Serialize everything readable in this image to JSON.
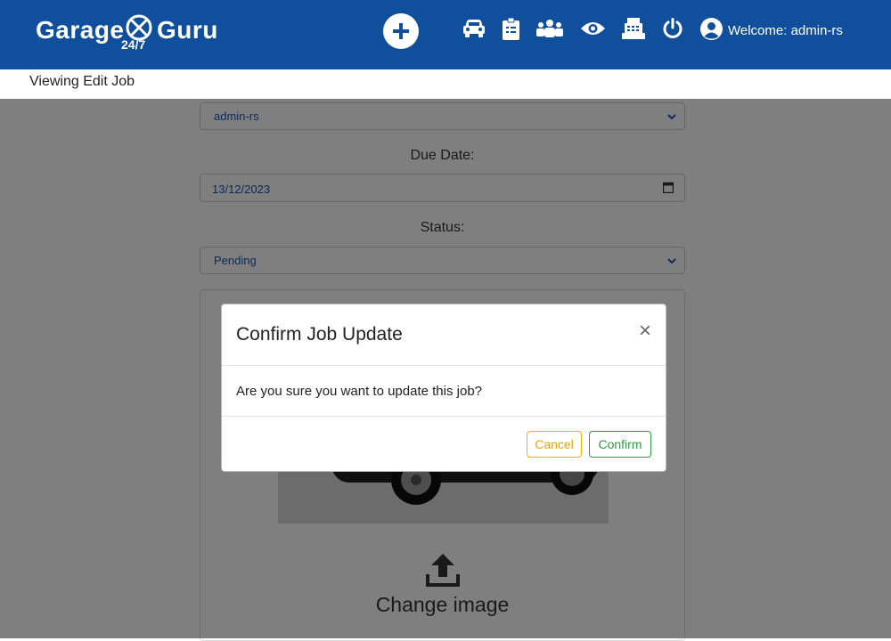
{
  "brand": {
    "name_part1": "Garage",
    "name_part2": "Guru",
    "tagline": "24/7"
  },
  "nav": {
    "icons": [
      "plus-circle-icon",
      "car-icon",
      "clipboard-icon",
      "users-icon",
      "eye-icon",
      "cash-register-icon",
      "power-icon",
      "user-circle-icon"
    ],
    "welcome": "Welcome: admin-rs"
  },
  "subheader": {
    "title": "Viewing Edit Job"
  },
  "form": {
    "assigned_user": "admin-rs",
    "due_date_label": "Due Date:",
    "due_date_value": "13/12/2023",
    "status_label": "Status:",
    "status_value": "Pending",
    "change_image": "Change image"
  },
  "modal": {
    "title": "Confirm Job Update",
    "close": "×",
    "message": "Are you sure you want to update this job?",
    "cancel": "Cancel",
    "confirm": "Confirm"
  },
  "colors": {
    "navbar": "#0f4f9c",
    "cancel": "#e6a700",
    "confirm": "#2f9a44",
    "select_text": "#1a55b5"
  }
}
